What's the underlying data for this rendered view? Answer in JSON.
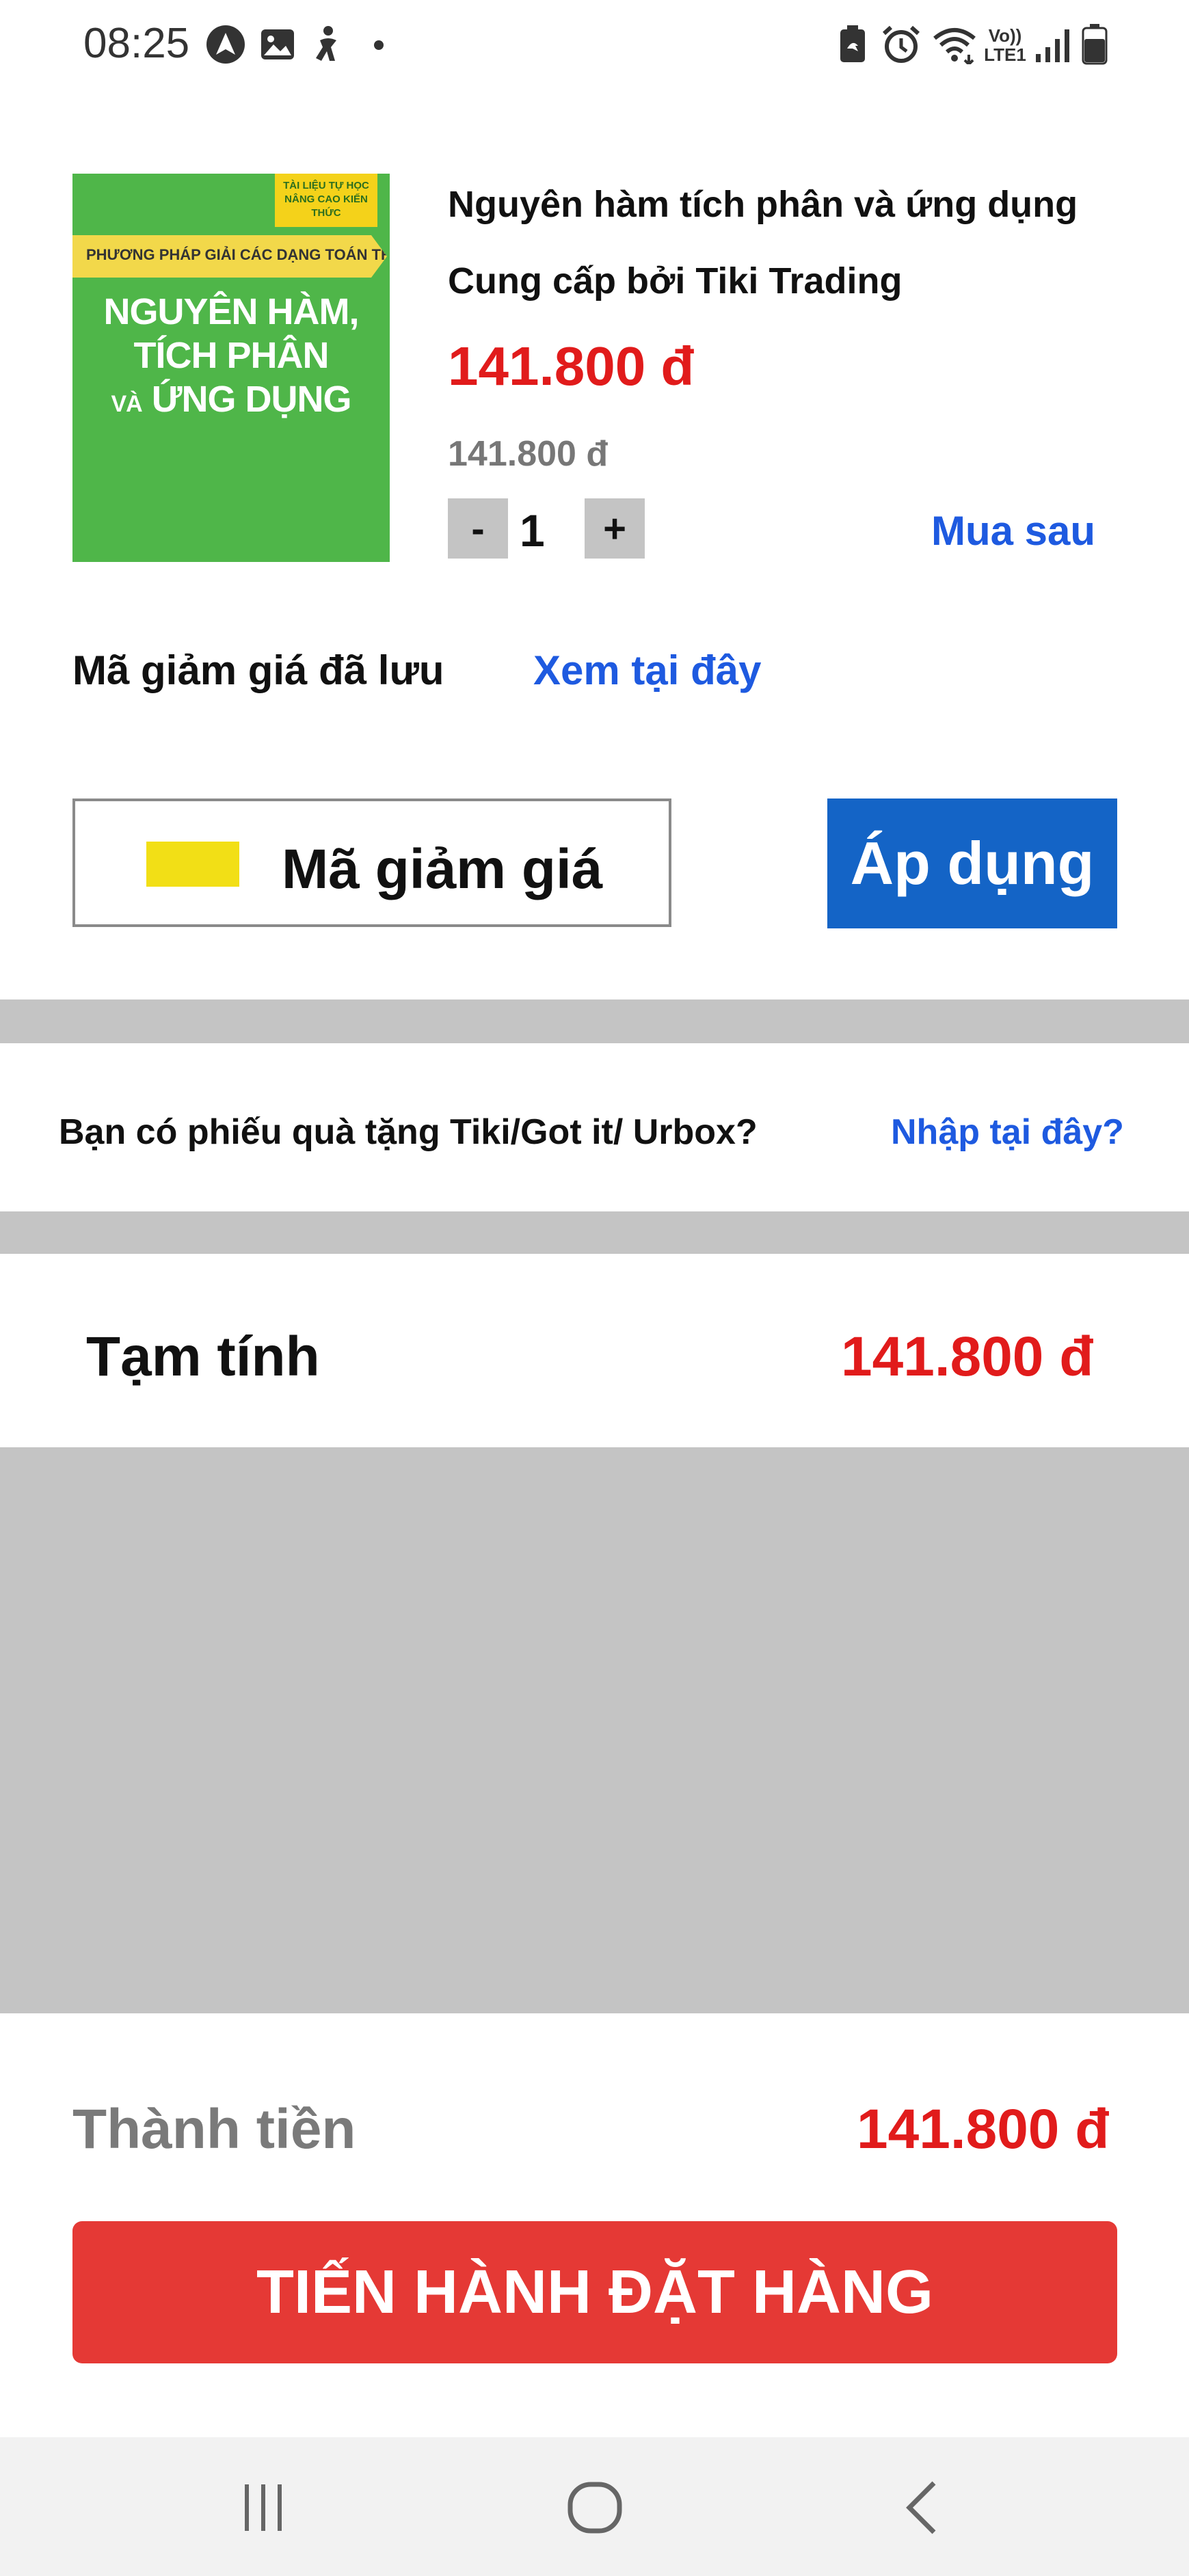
{
  "status_bar": {
    "time": "08:25",
    "left_icons": [
      "nav-arrow-icon",
      "image-icon",
      "accessibility-icon",
      "dot-icon"
    ],
    "right_icons": [
      "battery-saver-icon",
      "alarm-icon",
      "wifi-icon",
      "volte-icon",
      "signal-icon",
      "battery-icon"
    ],
    "volte_line1": "Vo))",
    "volte_line2": "LTE1"
  },
  "product": {
    "cover": {
      "header_small": "PHƯƠNG PHÁP GIẢI CÁC DẠNG TOÁN THPT",
      "corner_tag": "TÀI LIỆU TỰ HỌC NÂNG CAO KIẾN THỨC",
      "title_line1": "NGUYÊN HÀM,",
      "title_line2": "TÍCH PHÂN",
      "title_line3_small": "VÀ",
      "title_line3": "ỨNG DỤNG"
    },
    "name": "Nguyên hàm tích phân và ứng dụng",
    "provider": "Cung cấp bởi Tiki Trading",
    "price": "141.800 đ",
    "old_price": "141.800 đ",
    "quantity": "1",
    "minus_label": "-",
    "plus_label": "+",
    "buy_later_label": "Mua sau"
  },
  "coupon": {
    "saved_label": "Mã giảm giá đã lưu",
    "saved_link": "Xem tại đây",
    "input_placeholder": "Mã giảm giá",
    "apply_label": "Áp dụng"
  },
  "gift": {
    "question": "Bạn có phiếu quà tặng Tiki/Got it/ Urbox?",
    "link": "Nhập tại đây?"
  },
  "subtotal": {
    "label": "Tạm tính",
    "value": "141.800 đ"
  },
  "total": {
    "label": "Thành tiền",
    "value": "141.800 đ"
  },
  "checkout_button": "TIẾN HÀNH ĐẶT HÀNG",
  "nav_bar": {
    "icons": [
      "recent-apps-icon",
      "home-icon",
      "back-icon"
    ]
  },
  "colors": {
    "price_red": "#e11b1b",
    "link_blue": "#1e5ae0",
    "apply_blue": "#1464c6",
    "checkout_red": "#e53935",
    "separator_gray": "#c4c4c4"
  }
}
